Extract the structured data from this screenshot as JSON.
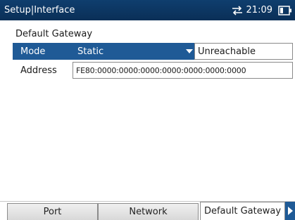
{
  "titlebar": {
    "title": "Setup|Interface",
    "time": "21:09",
    "icons": [
      "network-transfer-icon",
      "battery-icon"
    ]
  },
  "section": {
    "label": "Default Gateway"
  },
  "mode": {
    "label": "Mode",
    "selected_value": "Static",
    "status": "Unreachable"
  },
  "address": {
    "label": "Address",
    "value": "FE80:0000:0000:0000:0000:0000:0000:0000"
  },
  "tabs": [
    {
      "label": "Port"
    },
    {
      "label": "Network"
    },
    {
      "label": "Default Gateway"
    }
  ],
  "colors": {
    "titlebar": "#0a2f57",
    "selection": "#1f5a96"
  }
}
